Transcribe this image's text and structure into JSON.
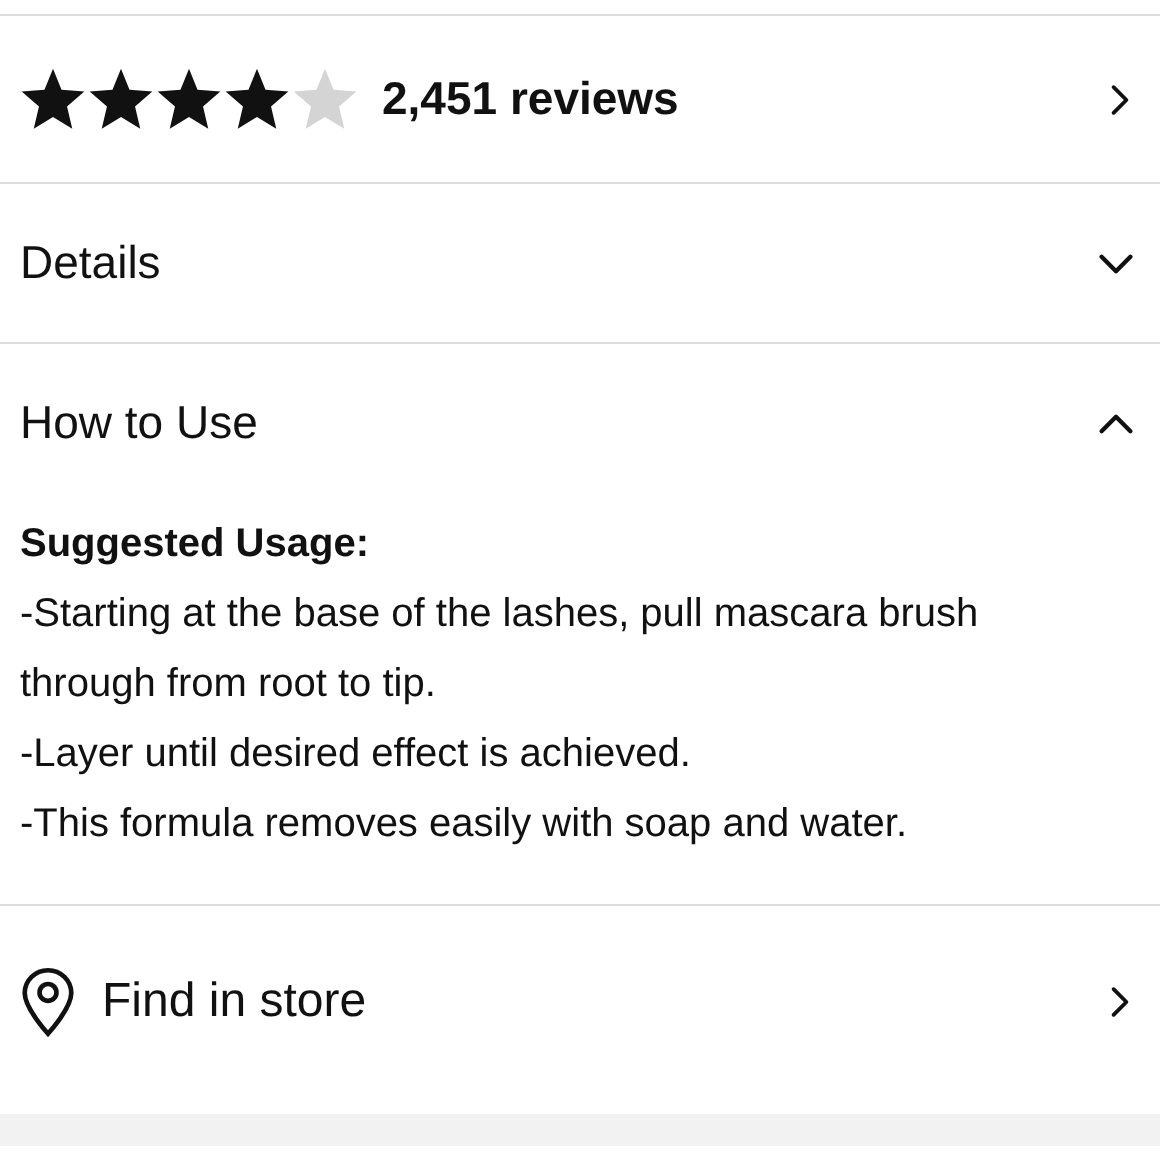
{
  "rating": {
    "stars": 4,
    "reviews": "2,451 reviews"
  },
  "sections": [
    {
      "title": "Details",
      "expanded": false
    },
    {
      "title": "How to Use",
      "expanded": true,
      "heading": "Suggested Usage:",
      "lines": [
        "-Starting at the base of the lashes, pull mascara brush through from root to tip.",
        "-Layer until desired effect is achieved.",
        "-This formula removes easily with soap and water."
      ]
    }
  ],
  "store": {
    "label": "Find in store"
  }
}
